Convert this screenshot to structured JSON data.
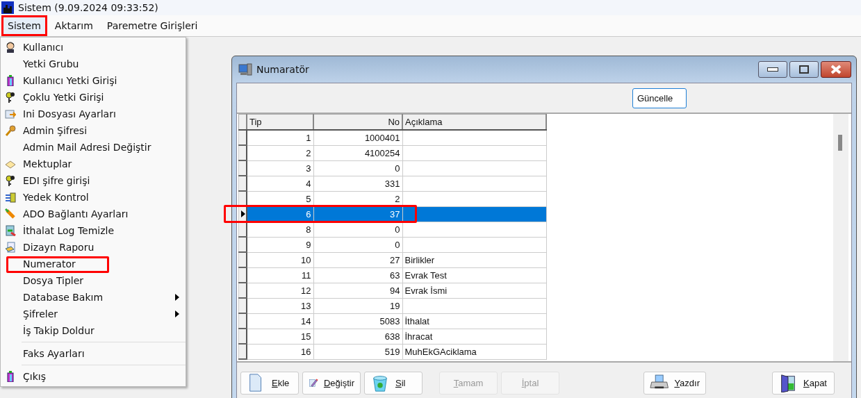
{
  "window": {
    "title": "Sistem (9.09.2024 09:33:52)"
  },
  "menu_bar": [
    {
      "label": "Sistem",
      "selected": true,
      "highlighted": true
    },
    {
      "label": "Aktarım",
      "selected": false,
      "highlighted": false
    },
    {
      "label": "Paremetre Girişleri",
      "selected": false,
      "highlighted": false
    }
  ],
  "dropdown": [
    {
      "kind": "item",
      "label": "Kullanıcı",
      "submenu": false,
      "highlighted": false
    },
    {
      "kind": "item",
      "label": "Yetki Grubu",
      "submenu": false,
      "highlighted": false
    },
    {
      "kind": "item",
      "label": "Kullanıcı Yetki Girişi",
      "submenu": false,
      "highlighted": false
    },
    {
      "kind": "item",
      "label": "Çoklu Yetki Girişi",
      "submenu": false,
      "highlighted": false
    },
    {
      "kind": "item",
      "label": "Ini Dosyası  Ayarları",
      "submenu": false,
      "highlighted": false
    },
    {
      "kind": "item",
      "label": "Admin Şifresi",
      "submenu": false,
      "highlighted": false
    },
    {
      "kind": "item",
      "label": "Admin Mail Adresi Değiştir",
      "submenu": false,
      "highlighted": false
    },
    {
      "kind": "item",
      "label": "Mektuplar",
      "submenu": false,
      "highlighted": false
    },
    {
      "kind": "item",
      "label": "EDI şifre girişi",
      "submenu": false,
      "highlighted": false
    },
    {
      "kind": "item",
      "label": "Yedek Kontrol",
      "submenu": false,
      "highlighted": false
    },
    {
      "kind": "item",
      "label": "ADO Bağlantı Ayarları",
      "submenu": false,
      "highlighted": false
    },
    {
      "kind": "item",
      "label": "İthalat Log Temizle",
      "submenu": false,
      "highlighted": false
    },
    {
      "kind": "item",
      "label": "Dizayn Raporu",
      "submenu": false,
      "highlighted": false
    },
    {
      "kind": "item",
      "label": "Numerator",
      "submenu": false,
      "highlighted": true
    },
    {
      "kind": "item",
      "label": "Dosya Tipler",
      "submenu": false,
      "highlighted": false
    },
    {
      "kind": "item",
      "label": "Database Bakım",
      "submenu": true,
      "highlighted": false
    },
    {
      "kind": "item",
      "label": "Şifreler",
      "submenu": true,
      "highlighted": false
    },
    {
      "kind": "item",
      "label": "İş Takip Doldur",
      "submenu": false,
      "highlighted": false
    },
    {
      "kind": "separator"
    },
    {
      "kind": "item",
      "label": "Faks Ayarları",
      "submenu": false,
      "highlighted": false
    },
    {
      "kind": "separator"
    },
    {
      "kind": "item",
      "label": "Çıkış",
      "submenu": false,
      "highlighted": false
    }
  ],
  "dialog": {
    "title": "Numaratör",
    "refresh_button": "Güncelle",
    "table": {
      "columns": [
        "Tip",
        "No",
        "Açıklama"
      ],
      "rows": [
        {
          "tip": "1",
          "no": "1000401",
          "aciklama": "",
          "selected": false,
          "highlighted": false
        },
        {
          "tip": "2",
          "no": "4100254",
          "aciklama": "",
          "selected": false,
          "highlighted": false
        },
        {
          "tip": "3",
          "no": "0",
          "aciklama": "",
          "selected": false,
          "highlighted": false
        },
        {
          "tip": "4",
          "no": "331",
          "aciklama": "",
          "selected": false,
          "highlighted": false
        },
        {
          "tip": "5",
          "no": "2",
          "aciklama": "",
          "selected": false,
          "highlighted": false
        },
        {
          "tip": "6",
          "no": "37",
          "aciklama": "",
          "selected": true,
          "highlighted": true
        },
        {
          "tip": "8",
          "no": "0",
          "aciklama": "",
          "selected": false,
          "highlighted": false
        },
        {
          "tip": "9",
          "no": "0",
          "aciklama": "",
          "selected": false,
          "highlighted": false
        },
        {
          "tip": "10",
          "no": "27",
          "aciklama": "Birlikler",
          "selected": false,
          "highlighted": false
        },
        {
          "tip": "11",
          "no": "63",
          "aciklama": "Evrak Test",
          "selected": false,
          "highlighted": false
        },
        {
          "tip": "12",
          "no": "94",
          "aciklama": "Evrak İsmi",
          "selected": false,
          "highlighted": false
        },
        {
          "tip": "13",
          "no": "19",
          "aciklama": "",
          "selected": false,
          "highlighted": false
        },
        {
          "tip": "14",
          "no": "5083",
          "aciklama": "İthalat",
          "selected": false,
          "highlighted": false
        },
        {
          "tip": "15",
          "no": "638",
          "aciklama": "İhracat",
          "selected": false,
          "highlighted": false
        },
        {
          "tip": "16",
          "no": "519",
          "aciklama": "MuhEkGAciklama",
          "selected": false,
          "highlighted": false
        }
      ]
    },
    "buttons": [
      {
        "label": "Ekle",
        "disabled": false
      },
      {
        "label": "Değiştir",
        "disabled": false
      },
      {
        "label": "Sil",
        "disabled": false
      },
      {
        "label": "Tamam",
        "disabled": true
      },
      {
        "label": "İptal",
        "disabled": true
      },
      {
        "label": "Yazdır",
        "disabled": false
      },
      {
        "label": "Kapat",
        "disabled": false
      }
    ]
  }
}
